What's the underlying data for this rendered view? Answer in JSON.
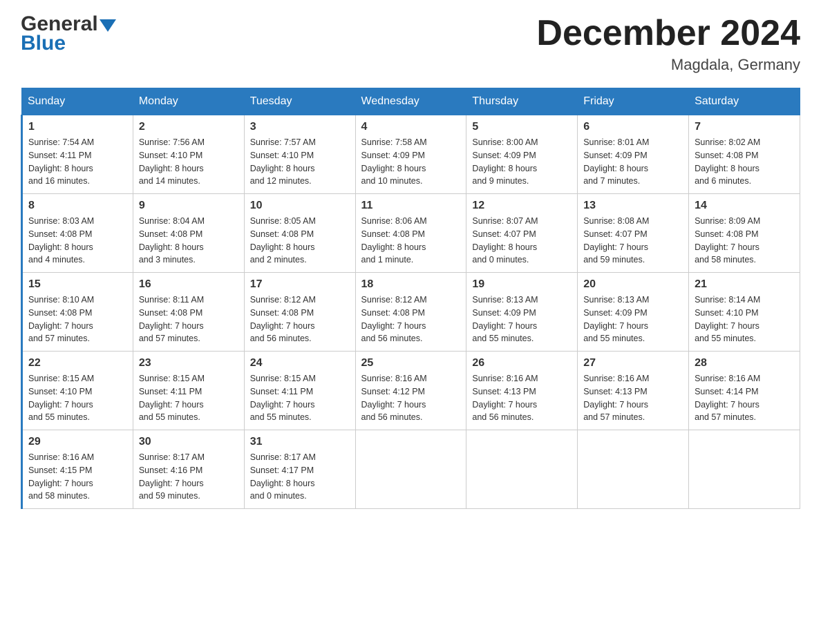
{
  "header": {
    "logo_general": "General",
    "logo_blue": "Blue",
    "month_title": "December 2024",
    "location": "Magdala, Germany"
  },
  "weekdays": [
    "Sunday",
    "Monday",
    "Tuesday",
    "Wednesday",
    "Thursday",
    "Friday",
    "Saturday"
  ],
  "weeks": [
    [
      {
        "day": "1",
        "info": "Sunrise: 7:54 AM\nSunset: 4:11 PM\nDaylight: 8 hours\nand 16 minutes."
      },
      {
        "day": "2",
        "info": "Sunrise: 7:56 AM\nSunset: 4:10 PM\nDaylight: 8 hours\nand 14 minutes."
      },
      {
        "day": "3",
        "info": "Sunrise: 7:57 AM\nSunset: 4:10 PM\nDaylight: 8 hours\nand 12 minutes."
      },
      {
        "day": "4",
        "info": "Sunrise: 7:58 AM\nSunset: 4:09 PM\nDaylight: 8 hours\nand 10 minutes."
      },
      {
        "day": "5",
        "info": "Sunrise: 8:00 AM\nSunset: 4:09 PM\nDaylight: 8 hours\nand 9 minutes."
      },
      {
        "day": "6",
        "info": "Sunrise: 8:01 AM\nSunset: 4:09 PM\nDaylight: 8 hours\nand 7 minutes."
      },
      {
        "day": "7",
        "info": "Sunrise: 8:02 AM\nSunset: 4:08 PM\nDaylight: 8 hours\nand 6 minutes."
      }
    ],
    [
      {
        "day": "8",
        "info": "Sunrise: 8:03 AM\nSunset: 4:08 PM\nDaylight: 8 hours\nand 4 minutes."
      },
      {
        "day": "9",
        "info": "Sunrise: 8:04 AM\nSunset: 4:08 PM\nDaylight: 8 hours\nand 3 minutes."
      },
      {
        "day": "10",
        "info": "Sunrise: 8:05 AM\nSunset: 4:08 PM\nDaylight: 8 hours\nand 2 minutes."
      },
      {
        "day": "11",
        "info": "Sunrise: 8:06 AM\nSunset: 4:08 PM\nDaylight: 8 hours\nand 1 minute."
      },
      {
        "day": "12",
        "info": "Sunrise: 8:07 AM\nSunset: 4:07 PM\nDaylight: 8 hours\nand 0 minutes."
      },
      {
        "day": "13",
        "info": "Sunrise: 8:08 AM\nSunset: 4:07 PM\nDaylight: 7 hours\nand 59 minutes."
      },
      {
        "day": "14",
        "info": "Sunrise: 8:09 AM\nSunset: 4:08 PM\nDaylight: 7 hours\nand 58 minutes."
      }
    ],
    [
      {
        "day": "15",
        "info": "Sunrise: 8:10 AM\nSunset: 4:08 PM\nDaylight: 7 hours\nand 57 minutes."
      },
      {
        "day": "16",
        "info": "Sunrise: 8:11 AM\nSunset: 4:08 PM\nDaylight: 7 hours\nand 57 minutes."
      },
      {
        "day": "17",
        "info": "Sunrise: 8:12 AM\nSunset: 4:08 PM\nDaylight: 7 hours\nand 56 minutes."
      },
      {
        "day": "18",
        "info": "Sunrise: 8:12 AM\nSunset: 4:08 PM\nDaylight: 7 hours\nand 56 minutes."
      },
      {
        "day": "19",
        "info": "Sunrise: 8:13 AM\nSunset: 4:09 PM\nDaylight: 7 hours\nand 55 minutes."
      },
      {
        "day": "20",
        "info": "Sunrise: 8:13 AM\nSunset: 4:09 PM\nDaylight: 7 hours\nand 55 minutes."
      },
      {
        "day": "21",
        "info": "Sunrise: 8:14 AM\nSunset: 4:10 PM\nDaylight: 7 hours\nand 55 minutes."
      }
    ],
    [
      {
        "day": "22",
        "info": "Sunrise: 8:15 AM\nSunset: 4:10 PM\nDaylight: 7 hours\nand 55 minutes."
      },
      {
        "day": "23",
        "info": "Sunrise: 8:15 AM\nSunset: 4:11 PM\nDaylight: 7 hours\nand 55 minutes."
      },
      {
        "day": "24",
        "info": "Sunrise: 8:15 AM\nSunset: 4:11 PM\nDaylight: 7 hours\nand 55 minutes."
      },
      {
        "day": "25",
        "info": "Sunrise: 8:16 AM\nSunset: 4:12 PM\nDaylight: 7 hours\nand 56 minutes."
      },
      {
        "day": "26",
        "info": "Sunrise: 8:16 AM\nSunset: 4:13 PM\nDaylight: 7 hours\nand 56 minutes."
      },
      {
        "day": "27",
        "info": "Sunrise: 8:16 AM\nSunset: 4:13 PM\nDaylight: 7 hours\nand 57 minutes."
      },
      {
        "day": "28",
        "info": "Sunrise: 8:16 AM\nSunset: 4:14 PM\nDaylight: 7 hours\nand 57 minutes."
      }
    ],
    [
      {
        "day": "29",
        "info": "Sunrise: 8:16 AM\nSunset: 4:15 PM\nDaylight: 7 hours\nand 58 minutes."
      },
      {
        "day": "30",
        "info": "Sunrise: 8:17 AM\nSunset: 4:16 PM\nDaylight: 7 hours\nand 59 minutes."
      },
      {
        "day": "31",
        "info": "Sunrise: 8:17 AM\nSunset: 4:17 PM\nDaylight: 8 hours\nand 0 minutes."
      },
      {
        "day": "",
        "info": ""
      },
      {
        "day": "",
        "info": ""
      },
      {
        "day": "",
        "info": ""
      },
      {
        "day": "",
        "info": ""
      }
    ]
  ]
}
